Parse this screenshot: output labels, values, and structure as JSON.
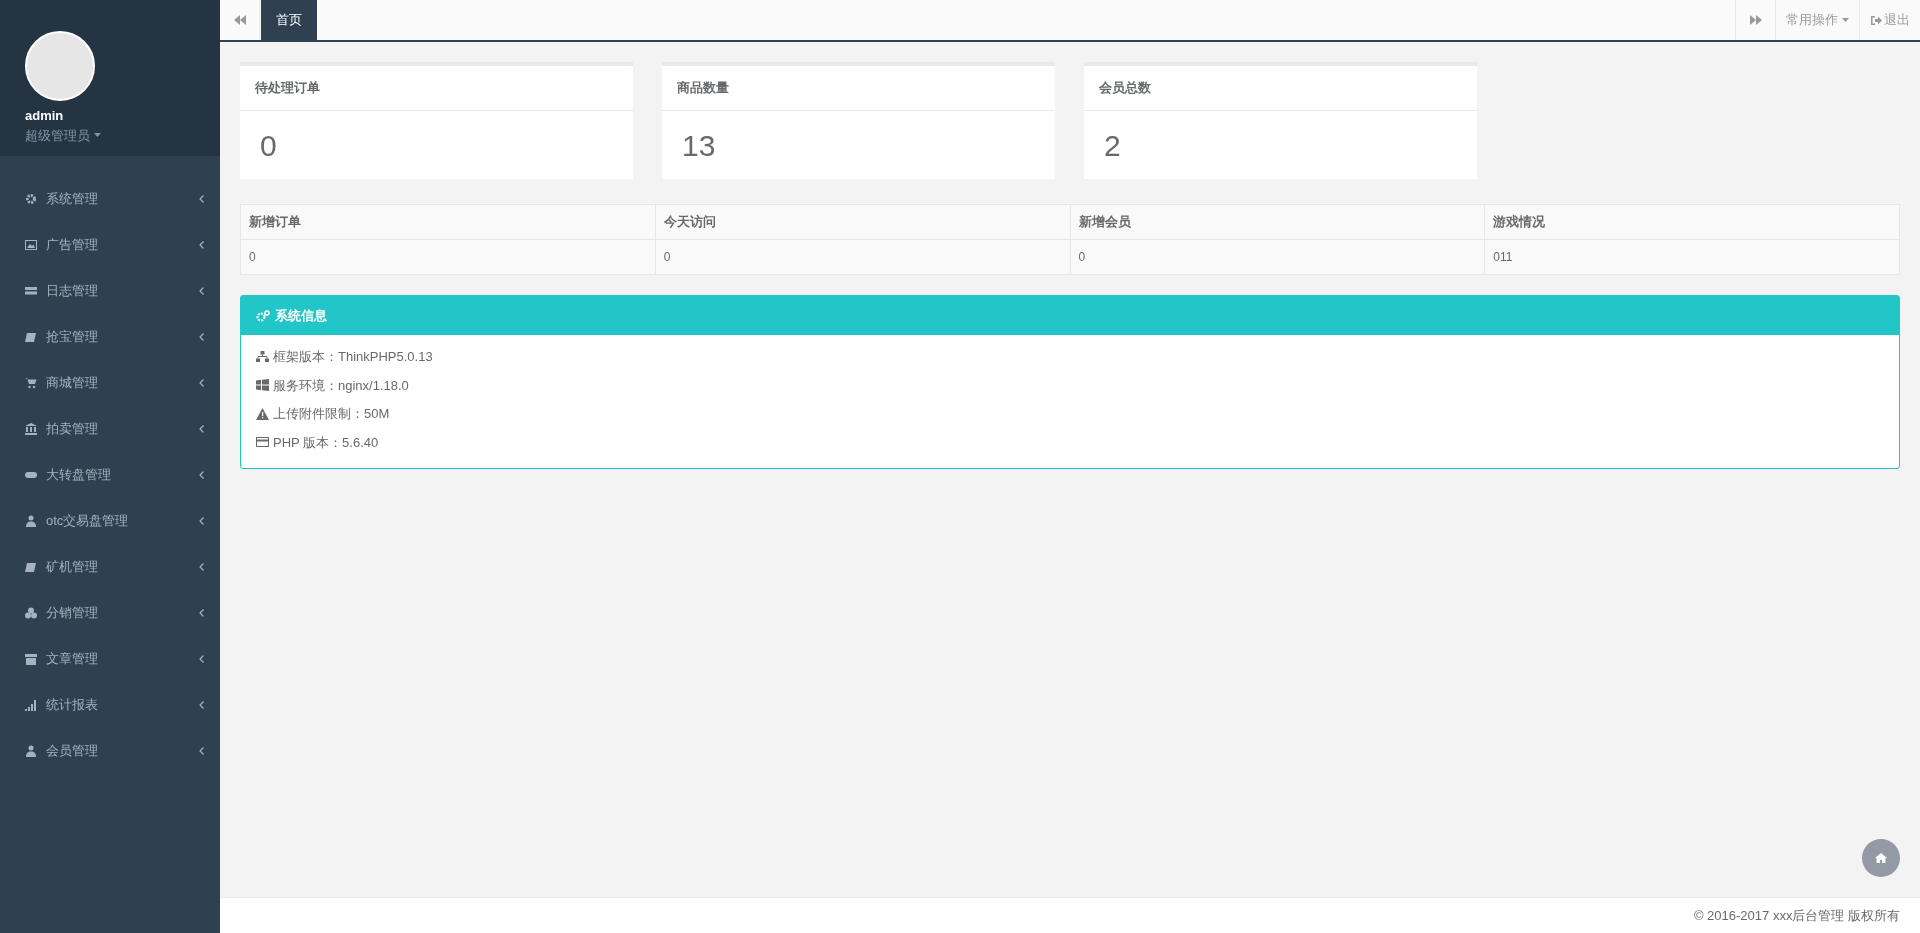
{
  "user": {
    "name": "admin",
    "role": "超级管理员"
  },
  "sidebar": {
    "items": [
      {
        "label": "系统管理"
      },
      {
        "label": "广告管理"
      },
      {
        "label": "日志管理"
      },
      {
        "label": "抢宝管理"
      },
      {
        "label": "商城管理"
      },
      {
        "label": "拍卖管理"
      },
      {
        "label": "大转盘管理"
      },
      {
        "label": "otc交易盘管理"
      },
      {
        "label": "矿机管理"
      },
      {
        "label": "分销管理"
      },
      {
        "label": "文章管理"
      },
      {
        "label": "统计报表"
      },
      {
        "label": "会员管理"
      }
    ]
  },
  "tabs": [
    {
      "label": "首页",
      "selected": true
    }
  ],
  "toolbar": {
    "operations": "常用操作",
    "logout": "退出"
  },
  "stat_cards": [
    {
      "title": "待处理订单",
      "value": "0"
    },
    {
      "title": "商品数量",
      "value": "13"
    },
    {
      "title": "会员总数",
      "value": "2"
    }
  ],
  "table": {
    "columns": [
      "新增订单",
      "今天访问",
      "新增会员",
      "游戏情况"
    ],
    "rows": [
      [
        "0",
        "0",
        "0",
        "011"
      ]
    ]
  },
  "system_info": {
    "title": "系统信息",
    "lines": [
      "框架版本：ThinkPHP5.0.13",
      "服务环境：nginx/1.18.0",
      "上传附件限制：50M",
      "PHP 版本：5.6.40"
    ]
  },
  "footer": "© 2016-2017 xxx后台管理 版权所有"
}
